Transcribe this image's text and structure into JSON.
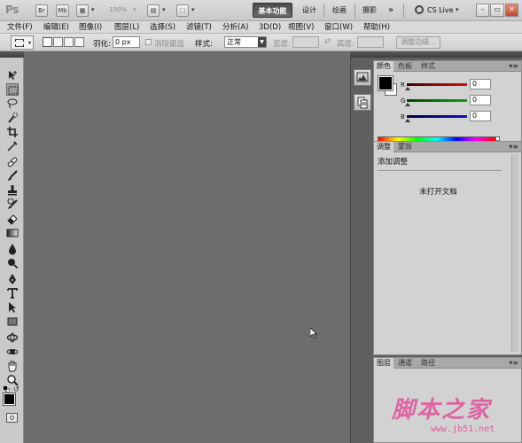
{
  "app": {
    "logo": "Ps",
    "bridge_button": "Br",
    "minibridge_button": "Mb",
    "zoom_level": "100%",
    "workspaces": [
      "基本功能",
      "设计",
      "绘画",
      "摄影"
    ],
    "active_workspace": "基本功能",
    "more_workspaces": "»",
    "cs_live": "CS Live",
    "window_controls": {
      "minimize": "–",
      "restore": "▭",
      "close": "✕"
    }
  },
  "menubar": {
    "items": [
      "文件(F)",
      "编辑(E)",
      "图像(I)",
      "图层(L)",
      "选择(S)",
      "滤镜(T)",
      "分析(A)",
      "3D(D)",
      "视图(V)",
      "窗口(W)",
      "帮助(H)"
    ]
  },
  "options": {
    "feather_label": "羽化:",
    "feather_value": "0 px",
    "antialias_label": "消除锯齿",
    "style_label": "样式:",
    "style_value": "正常",
    "width_label": "宽度:",
    "height_label": "高度:",
    "refine_edge_button": "调整边缘..."
  },
  "toolbox": {
    "tools": [
      "move-tool",
      "rectangular-marquee-tool",
      "lasso-tool",
      "quick-selection-tool",
      "crop-tool",
      "eyedropper-tool",
      "spot-healing-brush-tool",
      "brush-tool",
      "clone-stamp-tool",
      "history-brush-tool",
      "eraser-tool",
      "gradient-tool",
      "blur-tool",
      "dodge-tool",
      "pen-tool",
      "type-tool",
      "path-selection-tool",
      "rectangle-tool",
      "3d-rotate-tool",
      "3d-orbit-tool",
      "hand-tool",
      "zoom-tool"
    ],
    "selected_tool": "rectangular-marquee-tool",
    "foreground_color": "#000000",
    "background_color": "#ffffff"
  },
  "panels": {
    "color_panel": {
      "tabs": [
        "颜色",
        "色板",
        "样式"
      ],
      "active_tab": "颜色",
      "channels": [
        {
          "label": "R",
          "value": "0",
          "color": "#d01010"
        },
        {
          "label": "G",
          "value": "0",
          "color": "#10a010"
        },
        {
          "label": "B",
          "value": "0",
          "color": "#1010c0"
        }
      ]
    },
    "adjustments_panel": {
      "tabs": [
        "调整",
        "蒙版"
      ],
      "active_tab": "调整",
      "title": "添加调整",
      "message": "未打开文档"
    },
    "layers_panel": {
      "tabs": [
        "图层",
        "通道",
        "路径"
      ],
      "active_tab": "图层"
    },
    "panel_menu": "▾≡"
  },
  "watermark": {
    "title": "脚本之家",
    "url": "www.jb51.net"
  }
}
